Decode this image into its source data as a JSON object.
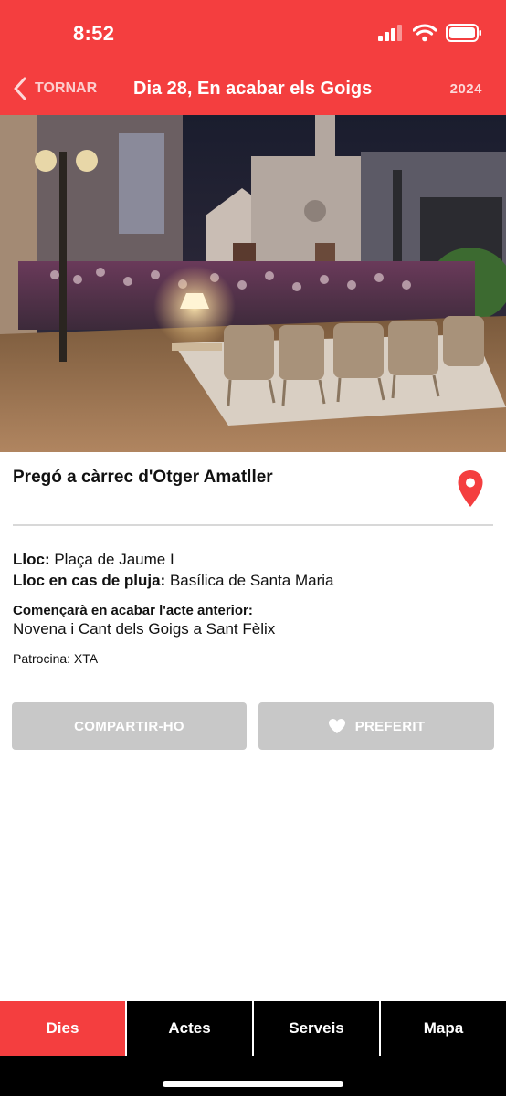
{
  "status_bar": {
    "time": "8:52"
  },
  "nav": {
    "back_label": "TORNAR",
    "title": "Dia 28, En acabar els Goigs",
    "year": "2024"
  },
  "event": {
    "title": "Pregó a càrrec d'Otger Amatller",
    "lloc_label": "Lloc:",
    "lloc_value": "Plaça de Jaume I",
    "pluja_label": "Lloc en cas de pluja:",
    "pluja_value": "Basílica de Santa Maria",
    "starts_label": "Començarà en acabar l'acte anterior:",
    "starts_value": "Novena i Cant dels Goigs a Sant Fèlix",
    "sponsor": "Patrocina: XTA"
  },
  "buttons": {
    "share": "COMPARTIR-HO",
    "favorite": "PREFERIT"
  },
  "tabs": [
    {
      "label": "Dies",
      "active": true
    },
    {
      "label": "Actes",
      "active": false
    },
    {
      "label": "Serveis",
      "active": false
    },
    {
      "label": "Mapa",
      "active": false
    }
  ],
  "colors": {
    "accent": "#f43e3f",
    "button_gray": "#c8c8c8",
    "tabbar": "#000000"
  }
}
